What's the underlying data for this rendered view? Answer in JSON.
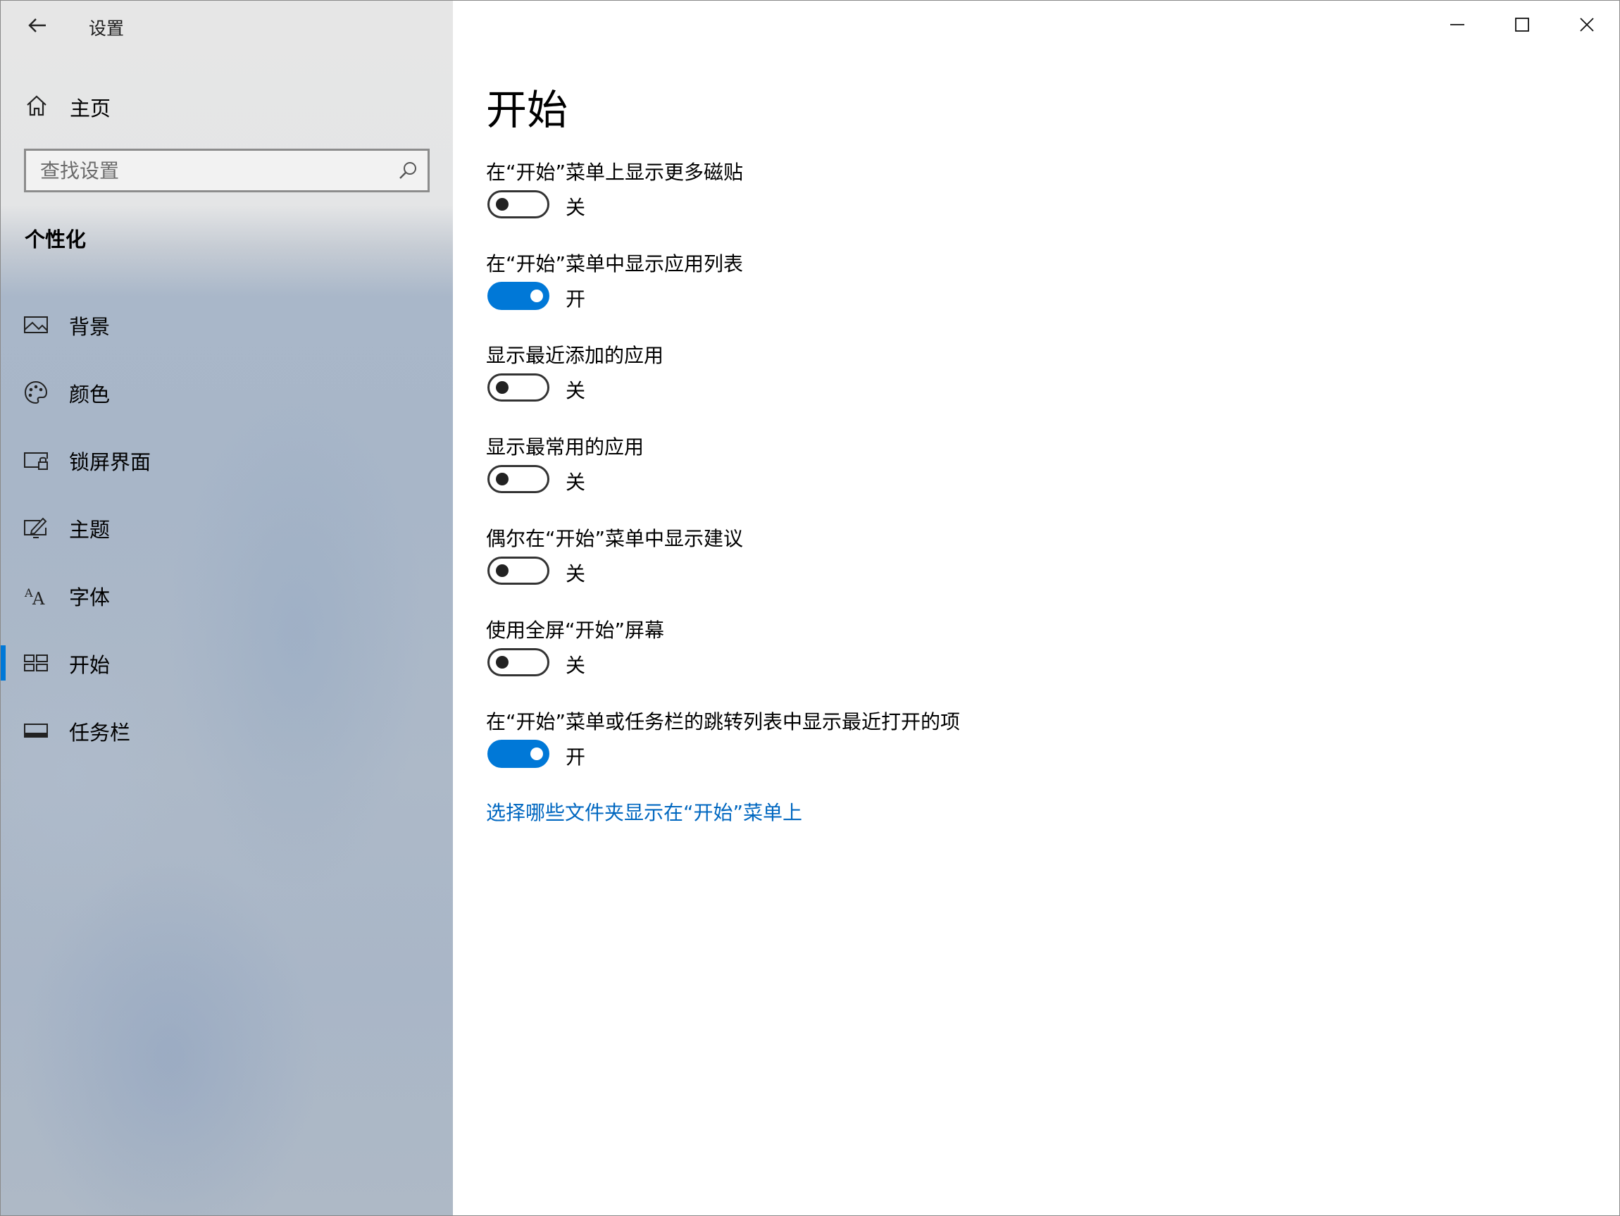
{
  "app": {
    "title": "设置"
  },
  "sidebar": {
    "home_label": "主页",
    "search_placeholder": "查找设置",
    "section_title": "个性化",
    "items": [
      {
        "label": "背景",
        "icon": "picture-icon"
      },
      {
        "label": "颜色",
        "icon": "palette-icon"
      },
      {
        "label": "锁屏界面",
        "icon": "lock-screen-icon"
      },
      {
        "label": "主题",
        "icon": "theme-icon"
      },
      {
        "label": "字体",
        "icon": "font-icon"
      },
      {
        "label": "开始",
        "icon": "start-tiles-icon",
        "selected": true
      },
      {
        "label": "任务栏",
        "icon": "taskbar-icon"
      }
    ]
  },
  "main": {
    "page_title": "开始",
    "settings": [
      {
        "label": "在“开始”菜单上显示更多磁贴",
        "state": "关",
        "on": false
      },
      {
        "label": "在“开始”菜单中显示应用列表",
        "state": "开",
        "on": true
      },
      {
        "label": "显示最近添加的应用",
        "state": "关",
        "on": false
      },
      {
        "label": "显示最常用的应用",
        "state": "关",
        "on": false
      },
      {
        "label": "偶尔在“开始”菜单中显示建议",
        "state": "关",
        "on": false
      },
      {
        "label": "使用全屏“开始”屏幕",
        "state": "关",
        "on": false
      },
      {
        "label": "在“开始”菜单或任务栏的跳转列表中显示最近打开的项",
        "state": "开",
        "on": true
      }
    ],
    "link_text": "选择哪些文件夹显示在“开始”菜单上"
  },
  "colors": {
    "accent": "#0078d7",
    "link": "#0067c0"
  }
}
